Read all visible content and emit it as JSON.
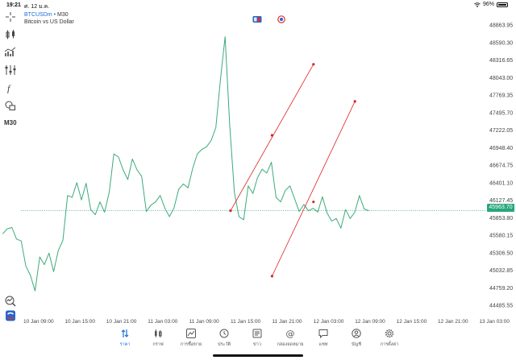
{
  "status_bar": {
    "time": "19:21",
    "date": "ศ. 12 ม.ค.",
    "battery": "96%"
  },
  "symbol": {
    "name": "BTCUSDm",
    "separator": "•",
    "timeframe": "M30",
    "description": "Bitcoin vs US Dollar"
  },
  "toolbar": {
    "timeframe_label": "M30",
    "icons": [
      "crosshair-icon",
      "candlestick-icon",
      "indicators-icon",
      "objects-icon",
      "function-icon",
      "shapes-icon",
      "timeframe-label",
      "zoom-icon",
      "app-logo-icon"
    ]
  },
  "colors": {
    "line": "#3daa7a",
    "trendline": "#e02020",
    "current_price": "#27a67a",
    "accent": "#1c6ed6"
  },
  "price_axis": {
    "labels": [
      "48863.95",
      "48590.30",
      "48316.65",
      "48043.00",
      "47769.35",
      "47495.70",
      "47222.05",
      "46948.40",
      "46674.75",
      "46401.10",
      "46127.45",
      "45853.80",
      "45580.15",
      "45306.50",
      "45032.85",
      "44759.20",
      "44485.55"
    ],
    "current_price": "45963.70"
  },
  "time_axis": {
    "labels": [
      "10 Jan 09:00",
      "10 Jan 15:00",
      "10 Jan 21:00",
      "11 Jan 03:00",
      "11 Jan 09:00",
      "11 Jan 15:00",
      "11 Jan 21:00",
      "12 Jan 03:00",
      "12 Jan 09:00",
      "12 Jan 15:00",
      "12 Jan 21:00",
      "13 Jan 03:00"
    ]
  },
  "chart_data": {
    "type": "line",
    "title": "",
    "xlabel": "",
    "ylabel": "",
    "ylim": [
      44400,
      49000
    ],
    "x_range": [
      "10 Jan 06:00",
      "12 Jan 11:00"
    ],
    "y": [
      45600,
      45680,
      45700,
      45520,
      45490,
      45100,
      44950,
      44710,
      45240,
      45120,
      45300,
      45010,
      45340,
      45500,
      46200,
      46170,
      46400,
      46130,
      46390,
      45980,
      45900,
      46100,
      45940,
      46250,
      46850,
      46800,
      46600,
      46450,
      46770,
      46600,
      46500,
      45950,
      46050,
      46100,
      46200,
      46000,
      45870,
      46010,
      46300,
      46380,
      46320,
      46620,
      46850,
      46920,
      46960,
      47060,
      47260,
      48010,
      48680,
      47300,
      46250,
      45870,
      45820,
      46350,
      46230,
      46480,
      46610,
      46550,
      46720,
      46170,
      46100,
      46280,
      46350,
      46150,
      45950,
      46060,
      45960,
      46000,
      45940,
      46180,
      45930,
      45800,
      45840,
      45690,
      45980,
      45840,
      45940,
      46200,
      45990,
      45963
    ]
  },
  "trendlines": [
    {
      "from": {
        "time": "11 Jan 15:00",
        "price": 45963
      },
      "mid": {
        "time": "11 Jan 21:00",
        "price": 47140
      },
      "to": {
        "time": "12 Jan 03:00",
        "price": 48250
      }
    },
    {
      "from": {
        "time": "11 Jan 21:00",
        "price": 44940
      },
      "mid": {
        "time": "12 Jan 03:00",
        "price": 46100
      },
      "to": {
        "time": "12 Jan 09:00",
        "price": 47670
      }
    }
  ],
  "tabbar": {
    "tabs": [
      {
        "label": "ราคา",
        "icon": "quotes-icon",
        "active": true
      },
      {
        "label": "กราฟ",
        "icon": "chart-icon",
        "active": false
      },
      {
        "label": "การซื้อขาย",
        "icon": "trade-icon",
        "active": false
      },
      {
        "label": "ประวัติ",
        "icon": "history-icon",
        "active": false
      },
      {
        "label": "ข่าว",
        "icon": "news-icon",
        "active": false
      },
      {
        "label": "กล่องจดหมาย",
        "icon": "mailbox-icon",
        "active": false
      },
      {
        "label": "แชท",
        "icon": "chat-icon",
        "active": false
      },
      {
        "label": "บัญชี",
        "icon": "account-icon",
        "active": false
      },
      {
        "label": "การตั้งค่า",
        "icon": "settings-icon",
        "active": false
      }
    ]
  }
}
